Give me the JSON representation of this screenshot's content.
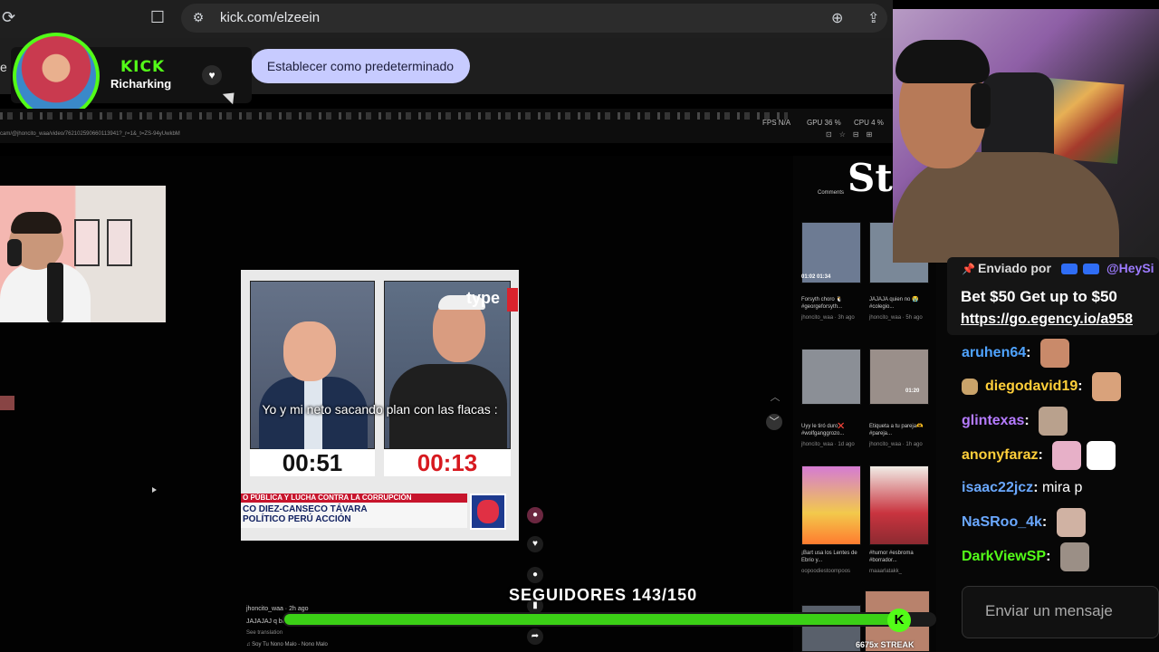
{
  "browser": {
    "url": "kick.com/elzeein",
    "default_button": "Establecer como predeterminado",
    "tab_partial": "e r"
  },
  "alert": {
    "brand": "KICK",
    "username": "Richarking"
  },
  "overlay_stats": {
    "fps": "FPS N/A",
    "gpu": "GPU 36 %",
    "cpu": "CPU 4 %"
  },
  "video": {
    "caption": "Yo y mi neto sacando plan con las flacas :",
    "timer_left": "00:51",
    "timer_right": "00:13",
    "channel_logo": "type",
    "lower_third_line1": "O PÚBLICA Y LUCHA CONTRA LA CORRUPCIÓN",
    "lower_third_line2": "CO DIEZ-CANSECO TÁVARA",
    "lower_third_line3": "POLÍTICO PERÚ ACCIÓN"
  },
  "comment": {
    "user": "jhoncito_waa · 2h ago",
    "text": "JAJAJAJ q bu",
    "translate": "See translation",
    "music": "♫  Soy Tu Nono Malo - Nono Malo"
  },
  "grid": {
    "logo": "St",
    "tab": "Comments",
    "items": [
      {
        "caption": "Forsyth choro 🐧 #georgeforsyth...",
        "meta": "jhoncito_waa · 3h ago",
        "timers": "01:02  01:34"
      },
      {
        "caption": "JAJAJA quien no 😭 #colegio...",
        "meta": "jhoncito_waa · 5h ago",
        "timers": ""
      },
      {
        "caption": "Uyy le tiró duro❌ #wolfganggrozo...",
        "meta": "jhoncito_waa · 1d ago",
        "timers": ""
      },
      {
        "caption": "Etiqueta a tu pareja🫶 #pareja...",
        "meta": "jhoncito_waa · 1h ago",
        "timers": "01:20"
      },
      {
        "caption": "¡Bart usa los Lentes de Ebrio y...",
        "meta": "oopoodiestoompoos",
        "timers": ""
      },
      {
        "caption": "#humor #esbroma #borrador...",
        "meta": "maaarlatakk_",
        "timers": ""
      }
    ]
  },
  "chat": {
    "pin_label": "Enviado por",
    "pin_sender": "@HeySi",
    "pin_message": "Bet $50 Get up to $50",
    "pin_link": "https://go.egency.io/a958",
    "messages": [
      {
        "user": "aruhen64",
        "text": "",
        "color": "#4fa3ff",
        "emotes": 1,
        "icon": false
      },
      {
        "user": "diegodavid19",
        "text": "",
        "color": "#ffcf3a",
        "emotes": 1,
        "icon": true
      },
      {
        "user": "glintexas",
        "text": "",
        "color": "#b57bff",
        "emotes": 1,
        "icon": false
      },
      {
        "user": "anonyfaraz",
        "text": "",
        "color": "#ffcf3a",
        "emotes": 2,
        "icon": false
      },
      {
        "user": "isaac22jcz",
        "text": "mira p",
        "color": "#6aa8ff",
        "emotes": 0,
        "icon": false
      },
      {
        "user": "NaSRoo_4k",
        "text": "",
        "color": "#6aa8ff",
        "emotes": 1,
        "icon": false
      },
      {
        "user": "DarkViewSP",
        "text": "",
        "color": "#53fc18",
        "emotes": 1,
        "icon": false
      }
    ],
    "input_placeholder": "Enviar un mensaje"
  },
  "goal": {
    "label": "SEGUIDORES 143/150",
    "current": 143,
    "target": 150,
    "knob_letter": "K",
    "streak": "6675x STREAK"
  },
  "colors": {
    "kick_green": "#53fc18",
    "accent_button": "#c7cbff"
  }
}
